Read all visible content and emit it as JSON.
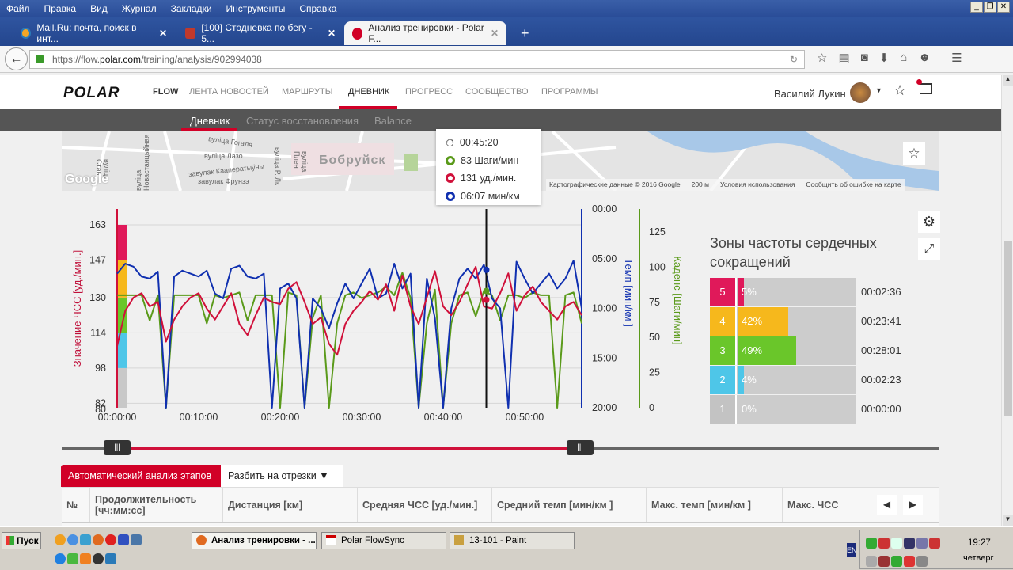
{
  "browser": {
    "menu": [
      "Файл",
      "Правка",
      "Вид",
      "Журнал",
      "Закладки",
      "Инструменты",
      "Справка"
    ],
    "tabs": [
      {
        "label": "Mail.Ru: почта, поиск в инт...",
        "color": "#f5a623"
      },
      {
        "label": "[100] Стодневка по бегу - 5...",
        "color": "#c0392b"
      },
      {
        "label": "Анализ тренировки - Polar F...",
        "color": "#d10027"
      }
    ],
    "url_prefix": "https://flow.",
    "url_host": "polar.com",
    "url_path": "/training/analysis/902994038"
  },
  "header": {
    "logo": "POLAR",
    "flow": "FLOW",
    "nav": [
      "ЛЕНТА НОВОСТЕЙ",
      "МАРШРУТЫ",
      "ДНЕВНИК",
      "ПРОГРЕСС",
      "СООБЩЕСТВО",
      "ПРОГРАММЫ"
    ],
    "active_nav": 2,
    "user": "Василий Лукин",
    "subnav": [
      "Дневник",
      "Статус восстановления",
      "Balance"
    ]
  },
  "map": {
    "city": "Бобруйск",
    "streets": [
      "вуліца Гогаля",
      "вуліца Лазо",
      "завулак Кааператыўны",
      "завулак Фрунзэ",
      "вуліца Стан",
      "вуліца Новастанцыйная",
      "вуліца Р. Лк",
      "вуліца Плен"
    ],
    "google": "Google",
    "attribution": "Картографические данные © 2016 Google",
    "scale": "200 м",
    "terms": "Условия использования",
    "report": "Сообщить об ошибке на карте"
  },
  "tooltip": {
    "time": "00:45:20",
    "cadence": "83 Шаги/мин",
    "hr": "131 уд./мин.",
    "pace": "06:07 мин/км"
  },
  "chart_data": {
    "type": "line",
    "x_unit": "minutes",
    "x_ticks": [
      "00:00:00",
      "00:10:00",
      "00:20:00",
      "00:30:00",
      "00:40:00",
      "00:50:00"
    ],
    "xlim": [
      0,
      57
    ],
    "hr_axis": {
      "label": "Значение ЧСС [уд./мин.]",
      "ticks": [
        "163",
        "147",
        "130",
        "114",
        "98",
        "82",
        "80"
      ],
      "ylim": [
        80,
        172
      ]
    },
    "pace_axis": {
      "label": "Темп [мин/км ]",
      "ticks": [
        "00:00",
        "05:00",
        "10:00",
        "15:00",
        "20:00"
      ],
      "ylim": [
        0,
        20
      ]
    },
    "cadence_axis": {
      "label": "Каденс [Шаги/мин]",
      "ticks": [
        "0",
        "25",
        "50",
        "75",
        "100",
        "125"
      ],
      "ylim": [
        0,
        140
      ]
    },
    "cursor_minute": 45.3,
    "series": [
      {
        "name": "ЧСС",
        "color": "#d0103a",
        "values": [
          108,
          124,
          130,
          132,
          126,
          128,
          110,
          120,
          126,
          130,
          132,
          125,
          120,
          126,
          132,
          118,
          113,
          122,
          130,
          128,
          127,
          134,
          137,
          128,
          118,
          121,
          109,
          104,
          118,
          124,
          128,
          133,
          129,
          136,
          124,
          140,
          126,
          118,
          130,
          142,
          126,
          122,
          128,
          136,
          144,
          126,
          125,
          132,
          141,
          124,
          131,
          135,
          128,
          124,
          120,
          126,
          128,
          122
        ]
      },
      {
        "name": "Темп",
        "color": "#1030b0",
        "values": [
          6.5,
          5.5,
          5.8,
          6.8,
          7,
          6.3,
          20,
          6.8,
          6.2,
          6.5,
          6.8,
          6.2,
          8.5,
          9,
          6,
          5.7,
          6.8,
          7,
          6.5,
          20,
          8,
          7.5,
          9,
          20,
          9,
          10,
          12,
          9.5,
          7.5,
          9,
          7.5,
          6,
          9,
          8.5,
          5.5,
          8,
          6.5,
          20,
          7,
          11,
          20,
          10,
          7,
          6,
          7,
          5.6,
          9,
          10,
          20,
          5.3,
          7,
          8.5,
          7.5,
          6.5,
          8,
          7,
          5.2,
          10
        ]
      },
      {
        "name": "Каденс",
        "color": "#5a9a1a",
        "values": [
          80,
          80,
          80,
          80,
          62,
          80,
          0,
          80,
          80,
          80,
          80,
          60,
          80,
          78,
          80,
          82,
          62,
          80,
          80,
          80,
          0,
          82,
          80,
          0,
          64,
          80,
          0,
          60,
          80,
          82,
          78,
          80,
          82,
          86,
          80,
          96,
          78,
          0,
          60,
          84,
          0,
          60,
          80,
          82,
          65,
          83,
          80,
          62,
          80,
          80,
          78,
          82,
          80,
          80,
          0,
          80,
          82,
          60
        ]
      }
    ],
    "hr_zone_colors": [
      "#c8c8c8",
      "#4ec6e8",
      "#6ac62a",
      "#f6b81c",
      "#e0195a"
    ]
  },
  "zones": {
    "title": "Зоны частоты сердечных сокращений",
    "rows": [
      {
        "zone": "5",
        "pct": "5%",
        "value": 5,
        "time": "00:02:36",
        "color": "#e0195a"
      },
      {
        "zone": "4",
        "pct": "42%",
        "value": 42,
        "time": "00:23:41",
        "color": "#f6b81c"
      },
      {
        "zone": "3",
        "pct": "49%",
        "value": 49,
        "time": "00:28:01",
        "color": "#6ac62a"
      },
      {
        "zone": "2",
        "pct": "4%",
        "value": 4,
        "time": "00:02:23",
        "color": "#4ec6e8"
      },
      {
        "zone": "1",
        "pct": "0%",
        "value": 0,
        "time": "00:00:00",
        "color": "#c3c3c3"
      }
    ]
  },
  "laps": {
    "auto_tab": "Автоматический анализ этапов",
    "split_tab": "Разбить на отрезки",
    "columns": [
      "№",
      "Продолжительность [чч:мм:сс]",
      "Дистанция [км]",
      "Средняя ЧСС [уд./мин.]",
      "Средний темп [мин/км ]",
      "Макс. темп [мин/км ]",
      "Макс. ЧСС"
    ]
  },
  "taskbar": {
    "start": "Пуск",
    "tasks": [
      "Анализ тренировки - ...",
      "Polar FlowSync",
      "13-101 - Paint"
    ],
    "lang": "EN",
    "time": "19:27",
    "day": "четверг"
  }
}
